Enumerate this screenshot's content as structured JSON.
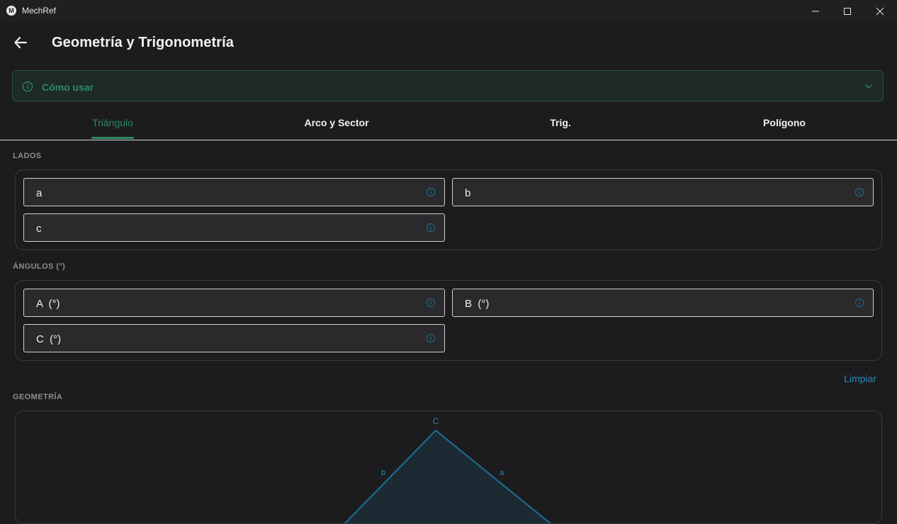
{
  "window": {
    "app_name": "MechRef",
    "logo_letter": "M"
  },
  "header": {
    "title": "Geometría y Trigonometría"
  },
  "howto": {
    "label": "Cómo usar"
  },
  "tabs": [
    {
      "label": "Triángulo",
      "active": true
    },
    {
      "label": "Arco y Sector",
      "active": false
    },
    {
      "label": "Trig.",
      "active": false
    },
    {
      "label": "Polígono",
      "active": false
    }
  ],
  "sections": {
    "sides": {
      "label": "LADOS",
      "fields": [
        {
          "label": "a",
          "value": ""
        },
        {
          "label": "b",
          "value": ""
        },
        {
          "label": "c",
          "value": ""
        }
      ]
    },
    "angles": {
      "label": "ÁNGULOS (°)",
      "fields": [
        {
          "label": "A  (°)",
          "value": ""
        },
        {
          "label": "B  (°)",
          "value": ""
        },
        {
          "label": "C  (°)",
          "value": ""
        }
      ]
    },
    "geometry": {
      "label": "GEOMETRÍA",
      "vertex_label": "C",
      "side_left_label": "b",
      "side_right_label": "a"
    }
  },
  "actions": {
    "clear_label": "Limpiar"
  },
  "colors": {
    "accent_green": "#2d8a5f",
    "accent_blue": "#2a87b6",
    "background": "#1c1c1e",
    "triangle_stroke": "#1b7096"
  }
}
